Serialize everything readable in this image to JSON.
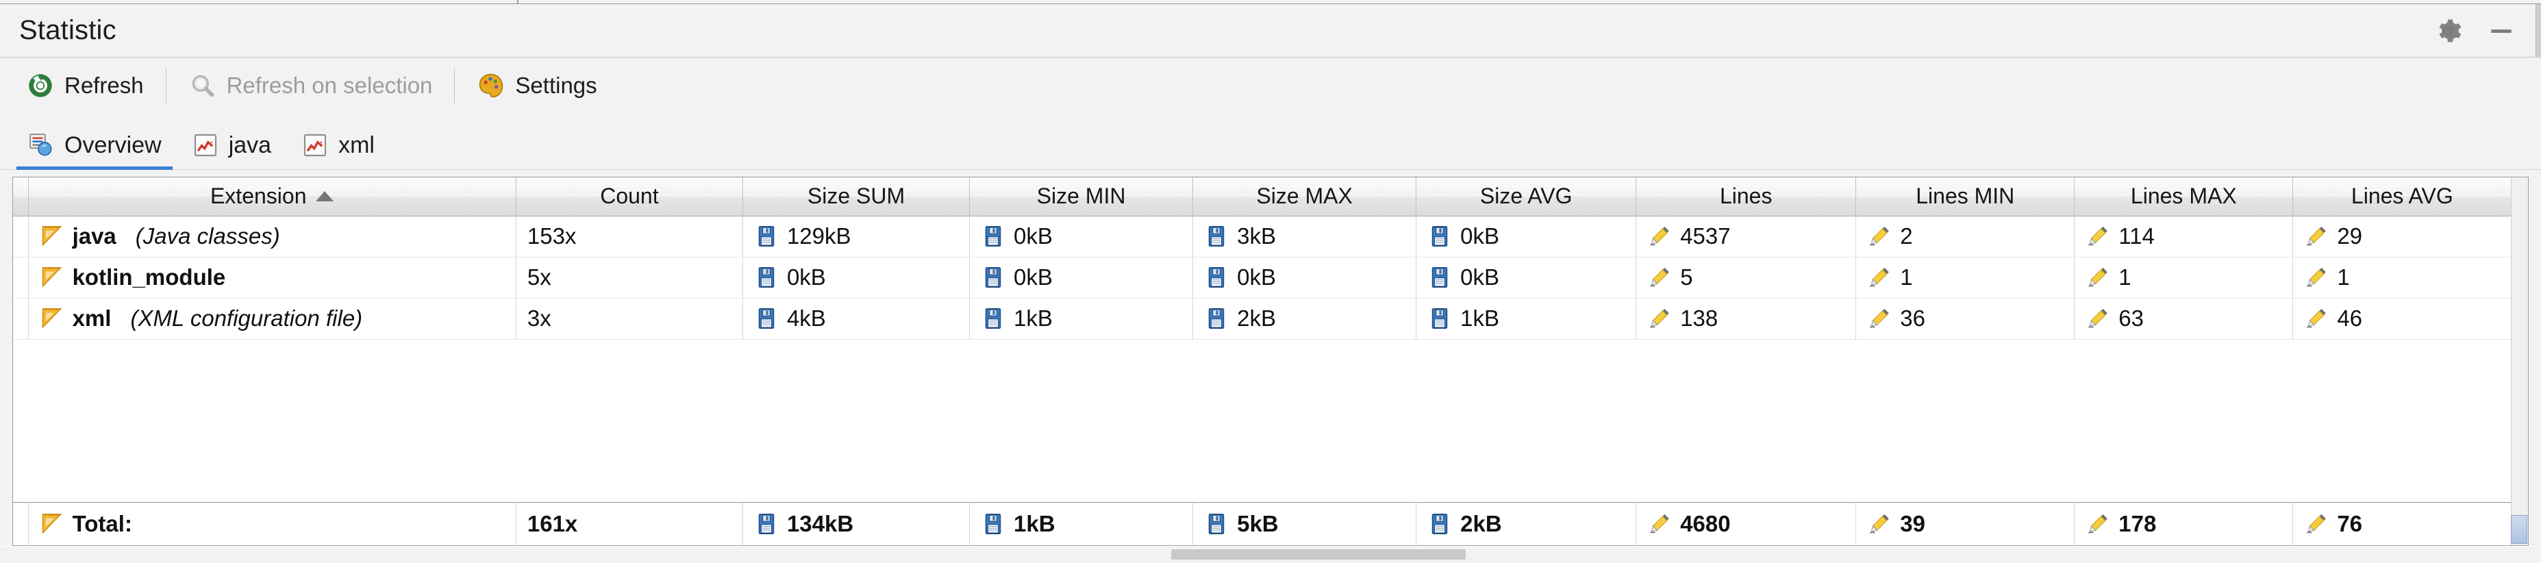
{
  "window": {
    "title": "Statistic",
    "gear_icon": "gear-icon",
    "minimize_icon": "minimize-icon"
  },
  "toolbar": {
    "items": [
      {
        "label": "Refresh",
        "icon": "refresh-icon",
        "enabled": true
      },
      {
        "label": "Refresh on selection",
        "icon": "magnifier-icon",
        "enabled": false
      },
      {
        "label": "Settings",
        "icon": "settings-palette-icon",
        "enabled": true
      }
    ]
  },
  "tabs": {
    "items": [
      {
        "label": "Overview",
        "icon": "overview-icon",
        "active": true
      },
      {
        "label": "java",
        "icon": "chart-icon",
        "active": false
      },
      {
        "label": "xml",
        "icon": "chart-icon",
        "active": false
      }
    ]
  },
  "table": {
    "sort": {
      "column": "Extension",
      "direction": "asc",
      "arrow": "sort-ascending-arrow"
    },
    "columns": [
      "Extension",
      "Count",
      "Size SUM",
      "Size MIN",
      "Size MAX",
      "Size AVG",
      "Lines",
      "Lines MIN",
      "Lines MAX",
      "Lines AVG"
    ],
    "rows": [
      {
        "extension": "java",
        "description": "(Java classes)",
        "extension_icon": "ruler-icon",
        "count": "153x",
        "size_sum": "129kB",
        "size_min": "0kB",
        "size_max": "3kB",
        "size_avg": "0kB",
        "lines": "4537",
        "lines_min": "2",
        "lines_max": "114",
        "lines_avg": "29"
      },
      {
        "extension": "kotlin_module",
        "description": "",
        "extension_icon": "ruler-icon",
        "count": "5x",
        "size_sum": "0kB",
        "size_min": "0kB",
        "size_max": "0kB",
        "size_avg": "0kB",
        "lines": "5",
        "lines_min": "1",
        "lines_max": "1",
        "lines_avg": "1"
      },
      {
        "extension": "xml",
        "description": "(XML configuration file)",
        "extension_icon": "ruler-icon",
        "count": "3x",
        "size_sum": "4kB",
        "size_min": "1kB",
        "size_max": "2kB",
        "size_avg": "1kB",
        "lines": "138",
        "lines_min": "36",
        "lines_max": "63",
        "lines_avg": "46"
      }
    ],
    "total": {
      "label": "Total:",
      "extension_icon": "ruler-icon",
      "count": "161x",
      "size_sum": "134kB",
      "size_min": "1kB",
      "size_max": "5kB",
      "size_avg": "2kB",
      "lines": "4680",
      "lines_min": "39",
      "lines_max": "178",
      "lines_avg": "76"
    },
    "icons": {
      "size_cell": "floppy-disk-icon",
      "lines_cell": "pencil-icon"
    }
  },
  "colors": {
    "accent": "#3b7fd4",
    "window_bg": "#f2f2f2",
    "table_bg": "#ffffff",
    "ruler_icon": "#f0a92b",
    "floppy_icon": "#2d6fb5",
    "pencil_icon": "#f2c033"
  }
}
